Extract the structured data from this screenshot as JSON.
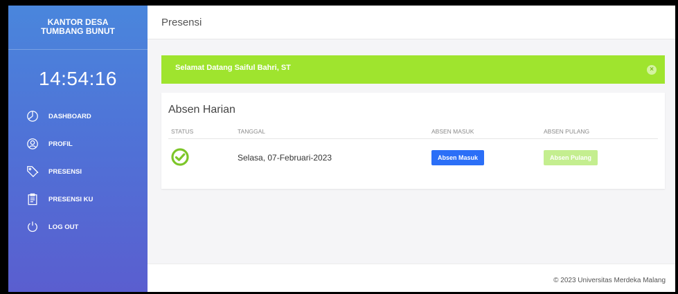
{
  "sidebar": {
    "brand": "KANTOR DESA TUMBANG BUNUT",
    "clock": "14:54:16",
    "items": [
      {
        "label": "DASHBOARD",
        "icon": "dashboard-gauge-icon"
      },
      {
        "label": "PROFIL",
        "icon": "user-circle-icon"
      },
      {
        "label": "PRESENSI",
        "icon": "tag-icon"
      },
      {
        "label": "PRESENSI KU",
        "icon": "clipboard-icon"
      },
      {
        "label": "LOG OUT",
        "icon": "power-icon"
      }
    ]
  },
  "header": {
    "title": "Presensi"
  },
  "alert": {
    "message": "Selamat Datang Saiful Bahri, ST",
    "close_glyph": "×",
    "color": "#9fe42e"
  },
  "card": {
    "title": "Absen Harian",
    "columns": [
      "STATUS",
      "TANGGAL",
      "ABSEN MASUK",
      "ABSEN PULANG"
    ],
    "row": {
      "status_icon": "check-circle-icon",
      "date": "Selasa, 07-Februari-2023",
      "masuk_label": "Absen Masuk",
      "pulang_label": "Absen Pulang"
    }
  },
  "footer": {
    "text": "© 2023 Universitas Merdeka Malang"
  },
  "colors": {
    "primary": "#2b6ff7",
    "success": "#7dc629",
    "sidebar_top": "#4a86dc",
    "sidebar_bottom": "#5a5ecf"
  }
}
